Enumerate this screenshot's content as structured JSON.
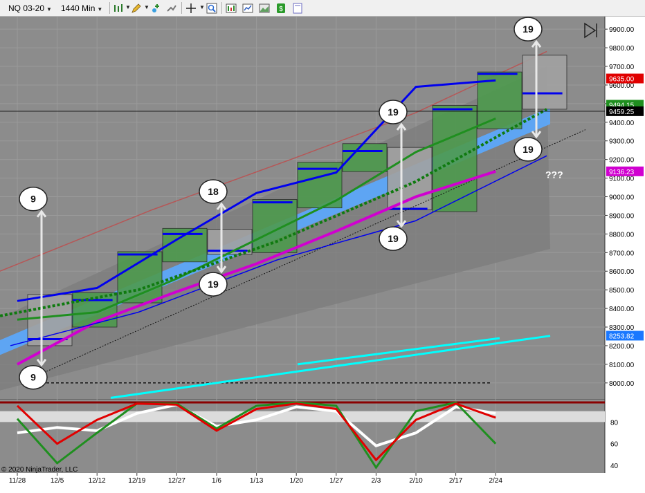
{
  "toolbar": {
    "instrument": "NQ 03-20",
    "timeframe": "1440 Min",
    "icons": [
      "bar-style-icon",
      "pencil-draw-icon",
      "add-indicator-icon",
      "strategy-icon",
      "crosshair-icon",
      "zoom-icon",
      "data-box-icon",
      "chart-properties-icon",
      "dollar-icon",
      "blank-page-icon"
    ]
  },
  "colors": {
    "panel_bg": "#8c8c8c",
    "grid": "#9a9a9a",
    "green_box": "#4e9a4e",
    "gray_box": "#a2a2a2",
    "magenta": "#d000d0",
    "cyan": "#00ffff",
    "blue": "#0000ee",
    "green": "#1f8f1f",
    "dark_green_dotted": "#0f7a0f",
    "light_blue_band": "#5aa8ff",
    "red_line": "#e00000",
    "white": "#ffffff"
  },
  "chart_data": [
    {
      "type": "line",
      "panel": "price",
      "y_axis_ticks": [
        "9900.00",
        "9800.00",
        "9700.00",
        "9600.00",
        "9500.00",
        "9400.00",
        "9300.00",
        "9200.00",
        "9100.00",
        "9000.00",
        "8900.00",
        "8800.00",
        "8700.00",
        "8600.00",
        "8500.00",
        "8400.00",
        "8300.00",
        "8200.00",
        "8100.00",
        "8000.00"
      ],
      "ylim": [
        7925,
        9960
      ],
      "x_axis_ticks": [
        "11/28",
        "12/5",
        "12/12",
        "12/19",
        "12/27",
        "1/6",
        "1/13",
        "1/20",
        "1/27",
        "2/3",
        "2/10",
        "2/17",
        "2/24"
      ],
      "price_flags": [
        {
          "label": "9635.00",
          "value": 9635,
          "color": "#e00000"
        },
        {
          "label": "9494.15",
          "value": 9494.15,
          "color": "#1f8f1f"
        },
        {
          "label": "9459.25",
          "value": 9459.25,
          "color": "#000000"
        },
        {
          "label": "9136.23",
          "value": 9136.23,
          "color": "#d000d0"
        },
        {
          "label": "8253.82",
          "value": 8253.82,
          "color": "#1a78ff"
        }
      ],
      "weekly_boxes": [
        {
          "week": "11/25",
          "open": 8430,
          "close": 8235,
          "high": 8475,
          "low": 8200
        },
        {
          "week": "12/2",
          "open": 8320,
          "close": 8445,
          "high": 8485,
          "low": 8300
        },
        {
          "week": "12/9",
          "open": 8440,
          "close": 8690,
          "high": 8705,
          "low": 8430
        },
        {
          "week": "12/16",
          "open": 8690,
          "close": 8800,
          "high": 8830,
          "low": 8650
        },
        {
          "week": "12/23",
          "open": 8800,
          "close": 8710,
          "high": 8825,
          "low": 8690
        },
        {
          "week": "12/30",
          "open": 8720,
          "close": 8970,
          "high": 8985,
          "low": 8700
        },
        {
          "week": "1/6",
          "open": 8950,
          "close": 9150,
          "high": 9185,
          "low": 8940
        },
        {
          "week": "1/13",
          "open": 9150,
          "close": 9245,
          "high": 9285,
          "low": 9135
        },
        {
          "week": "1/21",
          "open": 9240,
          "close": 8935,
          "high": 9265,
          "low": 8930
        },
        {
          "week": "1/27",
          "open": 8950,
          "close": 9470,
          "high": 9490,
          "low": 8920
        },
        {
          "week": "2/3",
          "open": 9470,
          "close": 9660,
          "high": 9670,
          "low": 9365
        },
        {
          "week": "2/10",
          "open": 9660,
          "close": 9555,
          "high": 9760,
          "low": 9470
        }
      ],
      "annotations": [
        {
          "text": "9",
          "price": 8988,
          "week_index": 0,
          "kind": "top"
        },
        {
          "text": "9",
          "price": 8030,
          "week_index": 0,
          "kind": "bottom"
        },
        {
          "text": "18",
          "price": 9028,
          "week_index": 4,
          "kind": "top"
        },
        {
          "text": "19",
          "price": 8530,
          "week_index": 4,
          "kind": "bottom"
        },
        {
          "text": "19",
          "price": 9455,
          "week_index": 8,
          "kind": "top"
        },
        {
          "text": "19",
          "price": 8775,
          "week_index": 8,
          "kind": "bottom"
        },
        {
          "text": "19",
          "price": 9900,
          "week_index": 11,
          "kind": "top"
        },
        {
          "text": "19",
          "price": 9255,
          "week_index": 11,
          "kind": "bottom"
        },
        {
          "text": "???",
          "price": 9115,
          "week_index": 11,
          "kind": "label"
        }
      ],
      "series": [
        {
          "name": "",
          "color": "#d000d0",
          "x": [
            "11/28",
            "12/12",
            "12/27",
            "1/13",
            "1/27",
            "2/10",
            "2/24"
          ],
          "values": [
            8100,
            8330,
            8490,
            8640,
            8815,
            9000,
            9136
          ]
        },
        {
          "name": "",
          "color": "#1f8f1f",
          "x": [
            "11/28",
            "12/12",
            "12/27",
            "1/13",
            "1/27",
            "2/10",
            "2/24"
          ],
          "values": [
            8340,
            8380,
            8560,
            8770,
            8980,
            9240,
            9420
          ]
        },
        {
          "name": "",
          "color": "#0000ee",
          "x": [
            "11/28",
            "12/12",
            "12/27",
            "1/13",
            "1/27",
            "2/10",
            "2/24"
          ],
          "values": [
            8440,
            8510,
            8770,
            9020,
            9130,
            9590,
            9625
          ]
        }
      ],
      "watermark": "© 2020 NinjaTrader, LLC"
    },
    {
      "type": "line",
      "panel": "oscillator",
      "y_axis_ticks": [
        "80",
        "60",
        "40"
      ],
      "ylim": [
        33,
        100
      ],
      "series": [
        {
          "name": "",
          "color": "#ffffff",
          "x": [
            "11/28",
            "12/5",
            "12/12",
            "12/19",
            "12/27",
            "1/6",
            "1/13",
            "1/20",
            "1/27",
            "2/3",
            "2/10",
            "2/17",
            "2/24"
          ],
          "values": [
            70,
            75,
            72,
            88,
            96,
            76,
            82,
            94,
            90,
            58,
            70,
            94,
            88
          ]
        },
        {
          "name": "",
          "color": "#1f8f1f",
          "x": [
            "11/28",
            "12/5",
            "12/12",
            "12/19",
            "12/27",
            "1/6",
            "1/13",
            "1/20",
            "1/27",
            "2/3",
            "2/10",
            "2/17",
            "2/24"
          ],
          "values": [
            83,
            42,
            70,
            97,
            97,
            74,
            95,
            98,
            95,
            38,
            90,
            98,
            60
          ]
        },
        {
          "name": "",
          "color": "#e00000",
          "x": [
            "11/28",
            "12/5",
            "12/12",
            "12/19",
            "12/27",
            "1/6",
            "1/13",
            "1/20",
            "1/27",
            "2/3",
            "2/10",
            "2/17",
            "2/24"
          ],
          "values": [
            95,
            60,
            82,
            97,
            96,
            72,
            92,
            97,
            92,
            45,
            82,
            97,
            84
          ]
        }
      ]
    }
  ]
}
